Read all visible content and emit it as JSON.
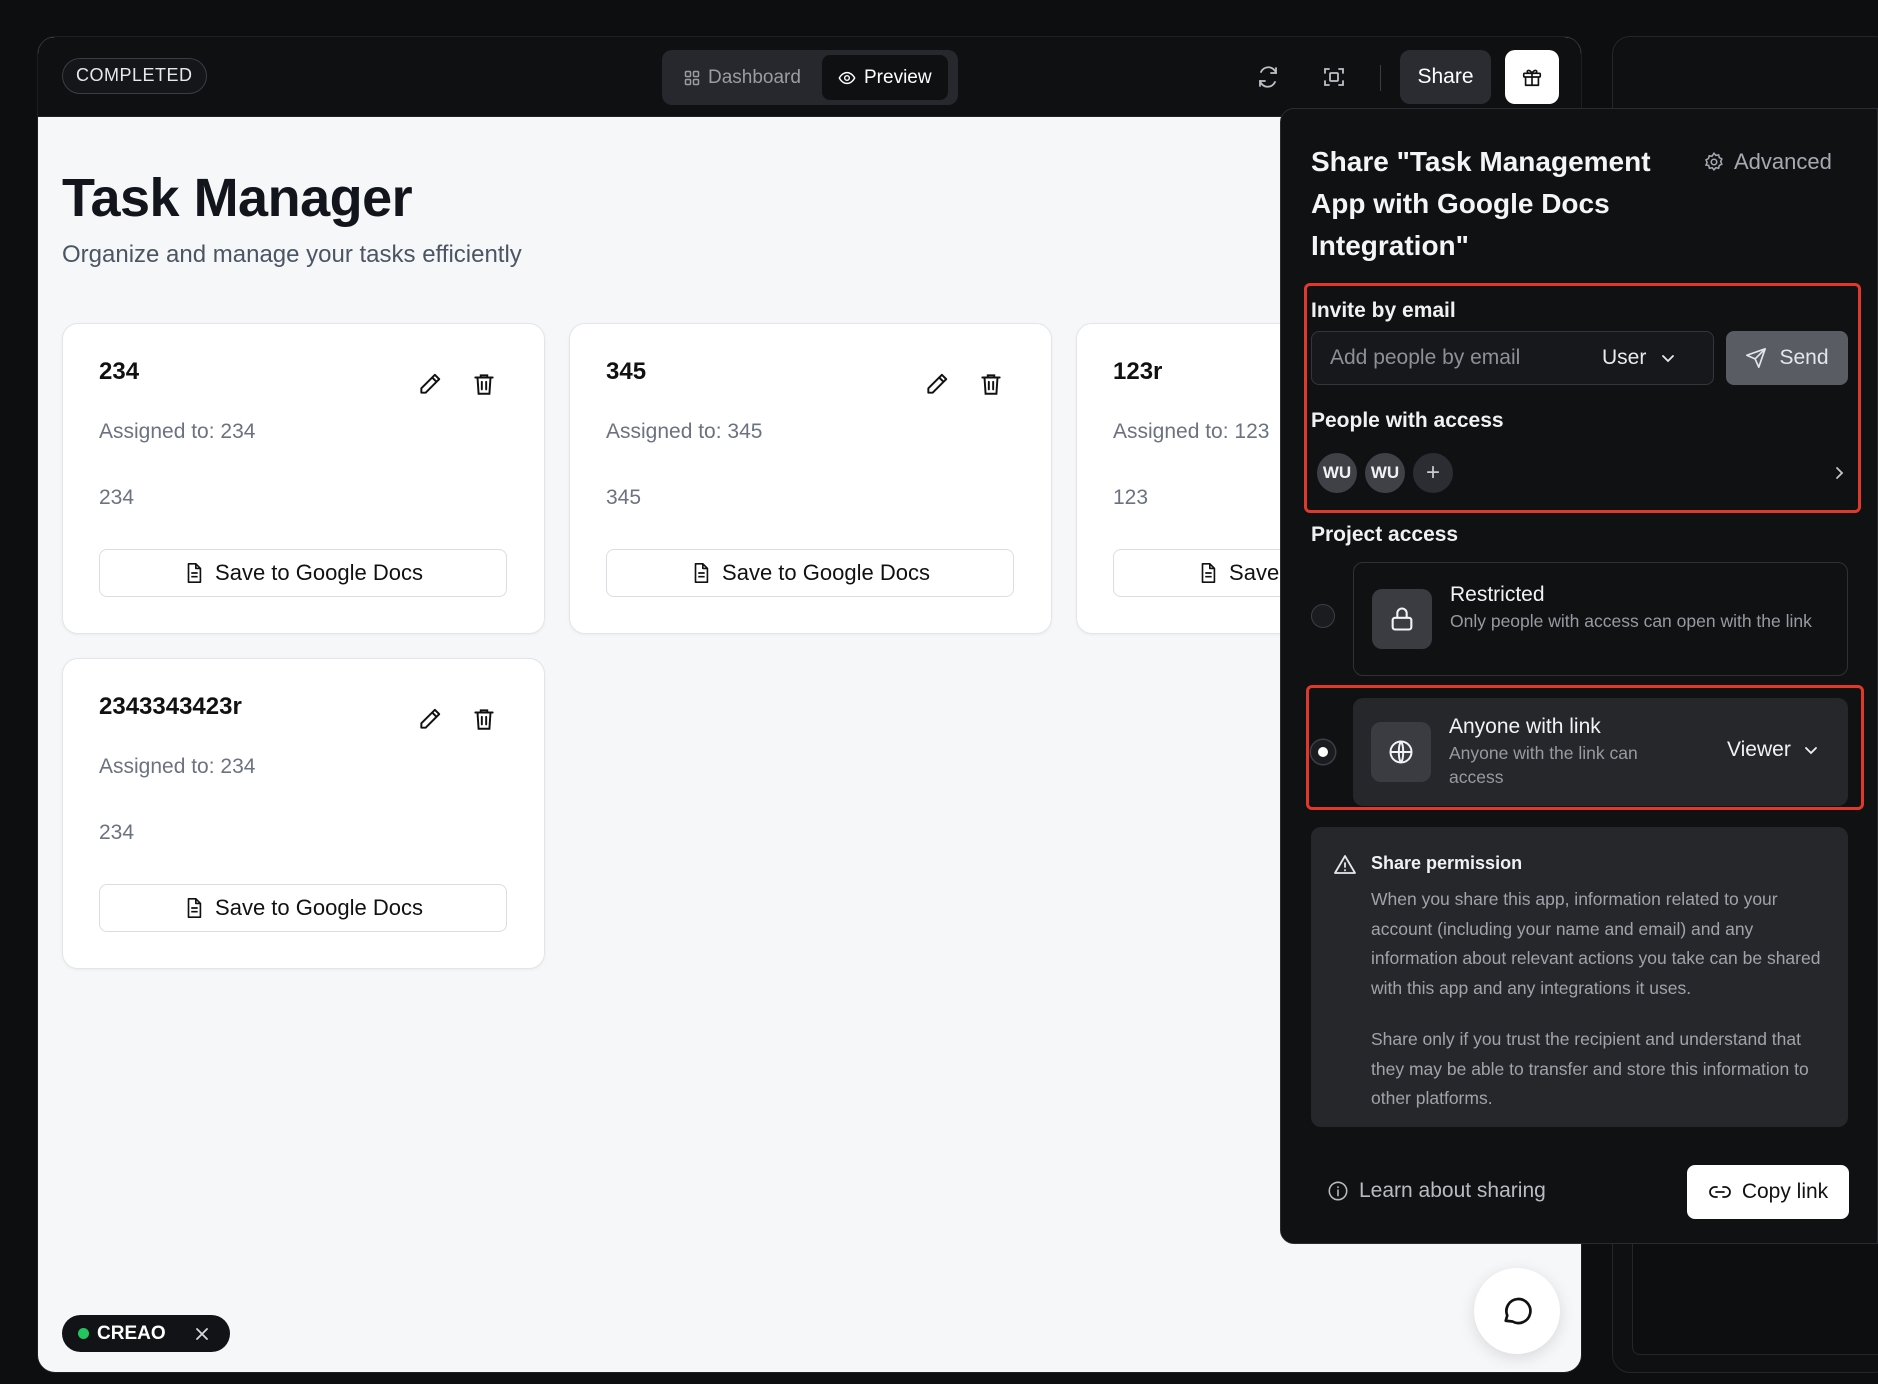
{
  "topbar": {
    "status_badge": "COMPLETED",
    "tabs": [
      {
        "label": "Dashboard",
        "icon": "grid-icon",
        "active": false
      },
      {
        "label": "Preview",
        "icon": "eye-icon",
        "active": true
      }
    ],
    "share_label": "Share",
    "icons": [
      "refresh-icon",
      "fullscreen-icon",
      "gift-icon"
    ]
  },
  "page": {
    "title": "Task Manager",
    "subtitle": "Organize and manage your tasks efficiently"
  },
  "cards": [
    {
      "title": "234",
      "assigned": "Assigned to: 234",
      "description": "234",
      "button": "Save to Google Docs"
    },
    {
      "title": "345",
      "assigned": "Assigned to: 345",
      "description": "345",
      "button": "Save to Google Docs"
    },
    {
      "title": "123r",
      "assigned": "Assigned to: 123",
      "description": "123",
      "button": "Save to Google Docs"
    },
    {
      "title": "2343343423r",
      "assigned": "Assigned to: 234",
      "description": "234",
      "button": "Save to Google Docs"
    }
  ],
  "footer_badge": {
    "label": "CREAO",
    "status_color": "#22c55e"
  },
  "share_panel": {
    "title": "Share \"Task Management App with Google Docs Integration\"",
    "advanced_label": "Advanced",
    "invite_label": "Invite by email",
    "email_placeholder": "Add people by email",
    "role_value": "User",
    "send_label": "Send",
    "people_label": "People with access",
    "people": [
      "WU",
      "WU"
    ],
    "add_person": "+",
    "project_access_label": "Project access",
    "options": [
      {
        "title": "Restricted",
        "description": "Only people with access can open with the link",
        "selected": false
      },
      {
        "title": "Anyone with link",
        "description": "Anyone with the link can access",
        "selected": true,
        "role": "Viewer"
      }
    ],
    "permission": {
      "title": "Share permission",
      "paragraphs": [
        "When you share this app, information related to your account (including your name and email) and any information about relevant actions you take can be shared with this app and any integrations it uses.",
        "Share only if you trust the recipient and understand that they may be able to transfer and store this information to other platforms."
      ]
    },
    "learn_label": "Learn about sharing",
    "copy_label": "Copy link"
  },
  "colors": {
    "highlight": "#e0392b",
    "accent": "#22c55e"
  }
}
